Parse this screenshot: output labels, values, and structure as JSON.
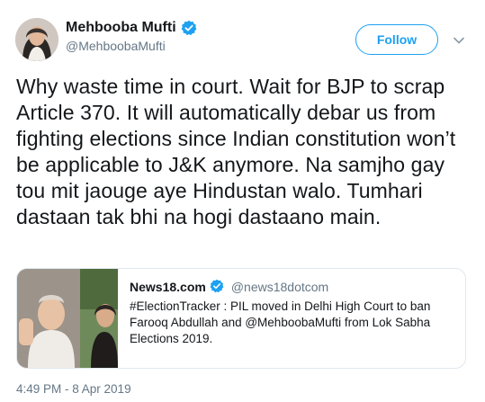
{
  "author": {
    "display_name": "Mehbooba Mufti",
    "handle": "@MehboobaMufti",
    "verified_icon": "verified-badge-icon"
  },
  "follow_label": "Follow",
  "tweet": {
    "text": "Why waste time in court. Wait for BJP to scrap Article 370. It will automatically debar us from fighting elections since Indian constitution won’t be applicable to J&K anymore. Na samjho gay tou mit jaouge aye Hindustan walo. Tumhari dastaan tak bhi na hogi dastaano main."
  },
  "quoted": {
    "name": "News18.com",
    "handle": "@news18dotcom",
    "text": "#ElectionTracker : PIL moved in Delhi High Court to ban Farooq Abdullah and @MehboobaMufti  from Lok Sabha Elections 2019."
  },
  "timestamp": "4:49 PM - 8 Apr 2019",
  "colors": {
    "accent": "#1da1f2",
    "text": "#14171a",
    "secondary": "#657786",
    "border": "#e1e8ed"
  }
}
